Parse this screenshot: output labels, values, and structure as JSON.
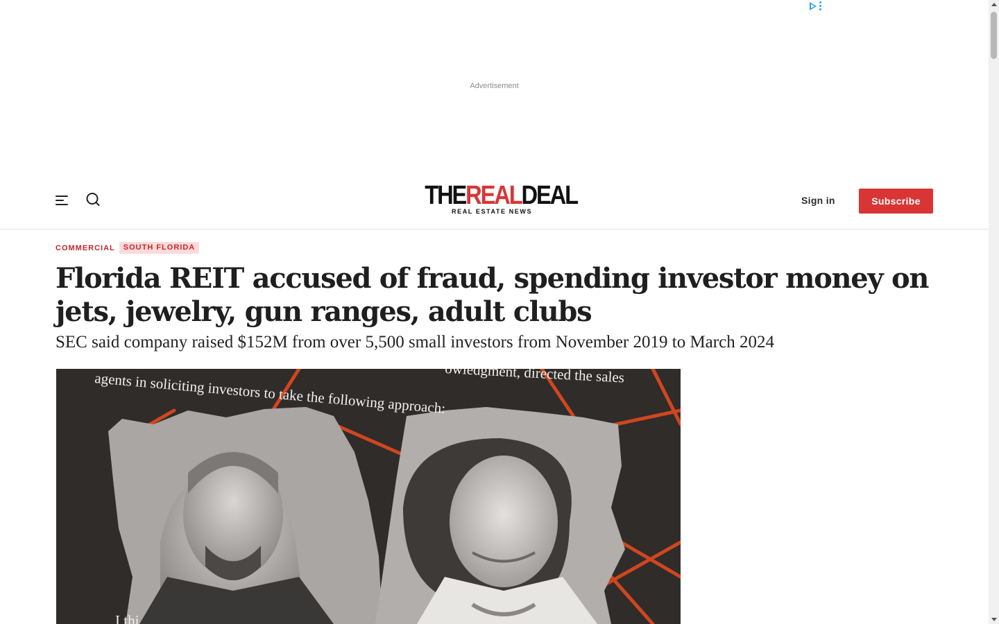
{
  "ad": {
    "label": "Advertisement",
    "choices_icon": "adchoices-icon"
  },
  "header": {
    "menu_icon": "hamburger-menu-icon",
    "search_icon": "search-icon",
    "logo": {
      "the": "THE",
      "real": "REAL",
      "deal": "DEAL",
      "tagline": "REAL ESTATE NEWS"
    },
    "signin_label": "Sign in",
    "subscribe_label": "Subscribe"
  },
  "article": {
    "tags": [
      {
        "label": "COMMERCIAL"
      },
      {
        "label": "SOUTH FLORIDA"
      }
    ],
    "headline": "Florida REIT accused of fraud, spending investor money on jets, jewelry, gun ranges, adult clubs",
    "dek": "SEC said company raised $152M from over 5,500 small investors from November 2019 to March 2024",
    "hero_image": {
      "text_top_left": "agents in soliciting investors to take the following approach:",
      "text_top_right": "owledgment, directed the sales",
      "text_bottom": "I thi"
    }
  },
  "colors": {
    "brand_red": "#d93535",
    "tag_red": "#c8252c",
    "tag_bg": "#fcdada",
    "adchoices_blue": "#29a3d9"
  }
}
